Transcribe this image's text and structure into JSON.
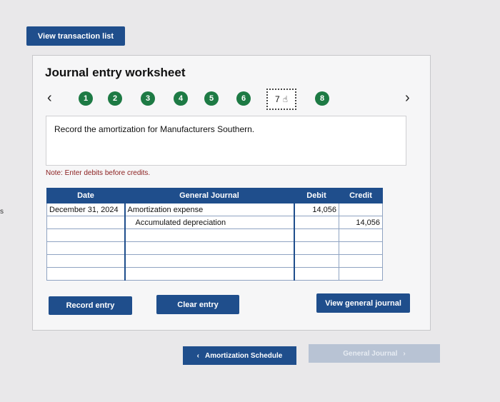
{
  "header": {
    "view_transactions_label": "View transaction list"
  },
  "worksheet": {
    "title": "Journal entry worksheet",
    "steps": [
      "1",
      "2",
      "3",
      "4",
      "5",
      "6",
      "7",
      "8"
    ],
    "current_step": "7",
    "prompt": "Record the amortization for Manufacturers Southern.",
    "note": "Note: Enter debits before credits."
  },
  "table": {
    "headers": {
      "date": "Date",
      "journal": "General Journal",
      "debit": "Debit",
      "credit": "Credit"
    },
    "rows": [
      {
        "date": "December 31, 2024",
        "account": "Amortization expense",
        "debit": "14,056",
        "credit": ""
      },
      {
        "date": "",
        "account": "Accumulated depreciation",
        "debit": "",
        "credit": "14,056"
      },
      {
        "date": "",
        "account": "",
        "debit": "",
        "credit": ""
      },
      {
        "date": "",
        "account": "",
        "debit": "",
        "credit": ""
      },
      {
        "date": "",
        "account": "",
        "debit": "",
        "credit": ""
      },
      {
        "date": "",
        "account": "",
        "debit": "",
        "credit": ""
      }
    ]
  },
  "actions": {
    "record_label": "Record entry",
    "clear_label": "Clear entry",
    "view_journal_label": "View general journal"
  },
  "footer": {
    "prev_label": "Amortization Schedule",
    "next_label": "General Journal"
  },
  "colors": {
    "primary": "#1f4e8c",
    "step_green": "#1d7a44",
    "note_red": "#8a1d1d"
  }
}
